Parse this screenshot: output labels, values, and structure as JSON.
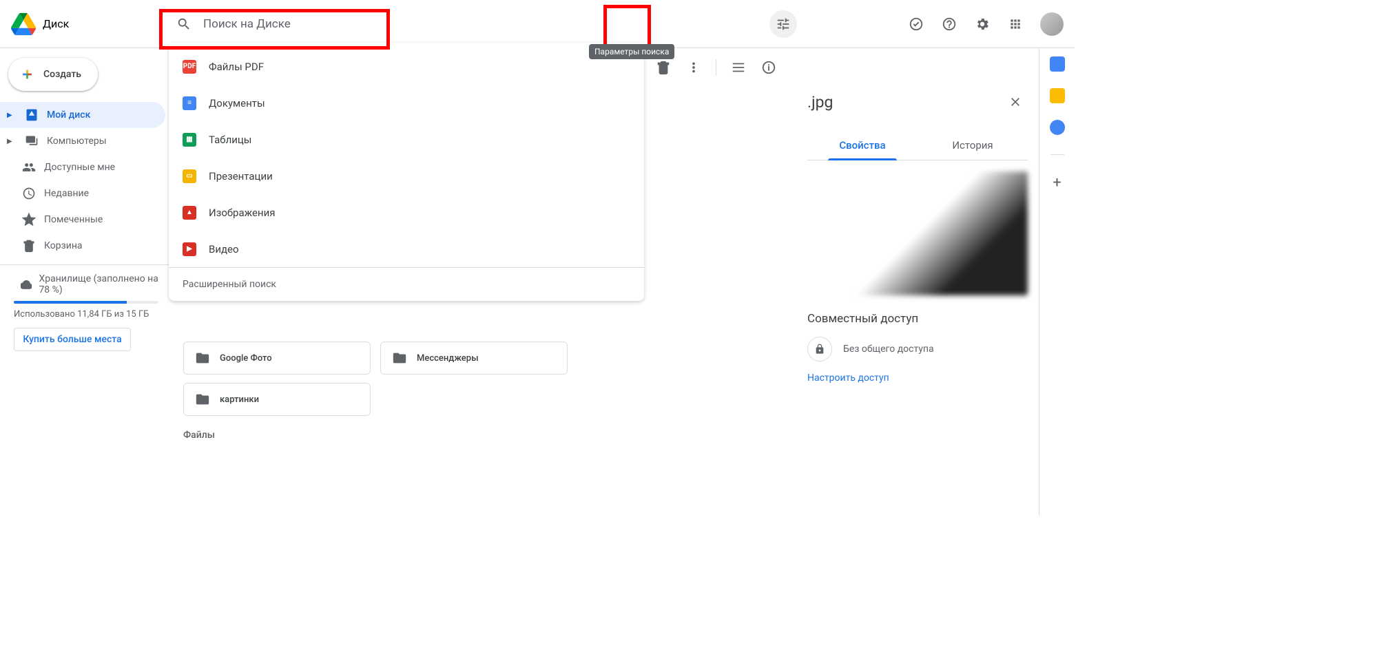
{
  "app_name": "Диск",
  "search": {
    "placeholder": "Поиск на Диске"
  },
  "tune_tooltip": "Параметры поиска",
  "new_button": "Создать",
  "nav": {
    "my_drive": "Мой диск",
    "computers": "Компьютеры",
    "shared": "Доступные мне",
    "recent": "Недавние",
    "starred": "Помеченные",
    "trash": "Корзина"
  },
  "storage": {
    "label": "Хранилище (заполнено на 78 %)",
    "used_text": "Использовано 11,84 ГБ из 15 ГБ",
    "buy": "Купить больше места"
  },
  "dropdown": {
    "pdf": "Файлы PDF",
    "docs": "Документы",
    "sheets": "Таблицы",
    "slides": "Презентации",
    "images": "Изображения",
    "videos": "Видео",
    "advanced": "Расширенный поиск"
  },
  "folders": {
    "google_photo": "Google Фото",
    "messengers": "Мессенджеры",
    "pictures": "картинки"
  },
  "files_label": "Файлы",
  "details": {
    "title_suffix": ".jpg",
    "tab_properties": "Свойства",
    "tab_history": "История",
    "sharing_title": "Совместный доступ",
    "sharing_status": "Без общего доступа",
    "manage": "Настроить доступ"
  }
}
